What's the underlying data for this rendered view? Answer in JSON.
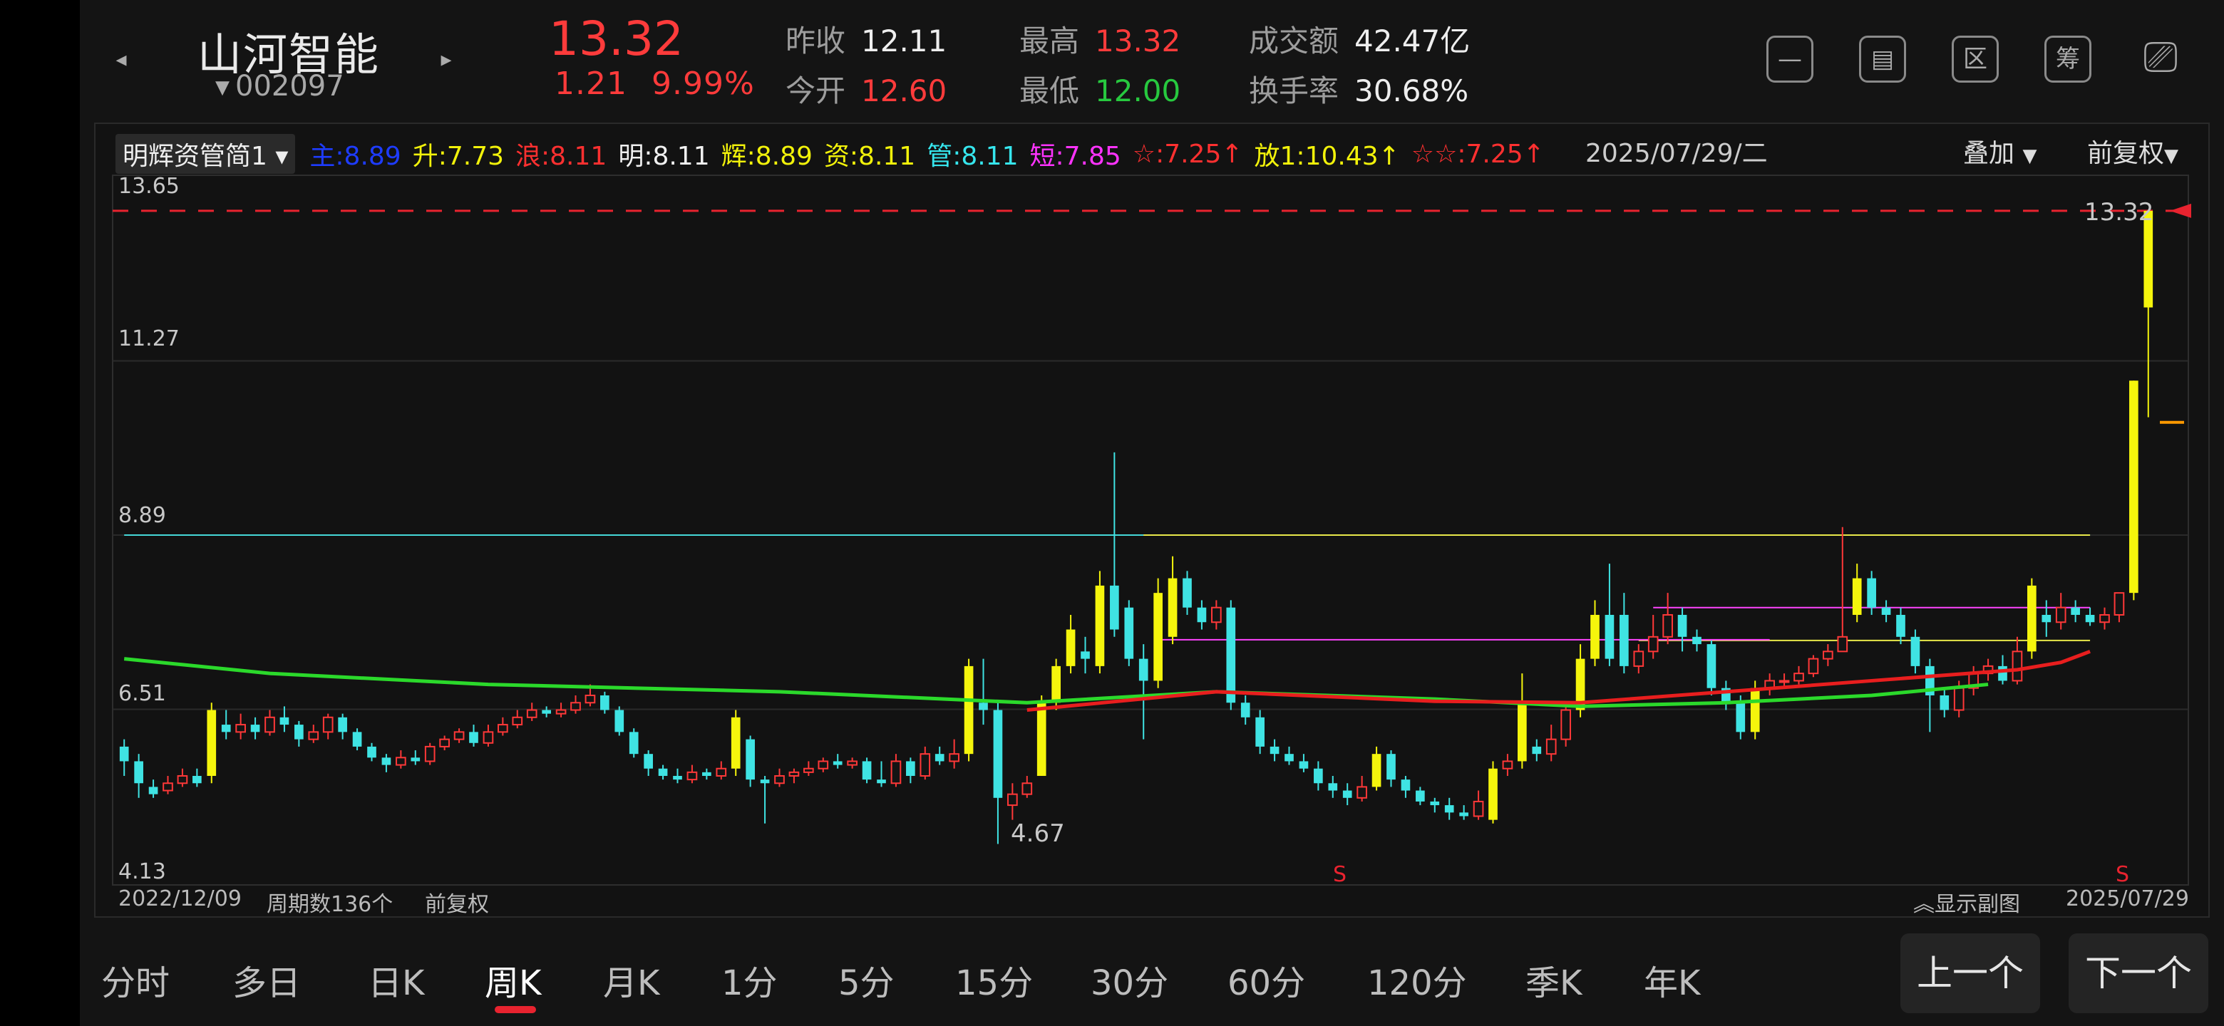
{
  "header": {
    "name": "山河智能",
    "code": "002097",
    "price": "13.32",
    "change": "1.21",
    "change_pct": "9.99%",
    "quotes": [
      {
        "k": "昨收",
        "v": "12.11",
        "c": "normal"
      },
      {
        "k": "今开",
        "v": "12.60",
        "c": "red"
      },
      {
        "k": "最高",
        "v": "13.32",
        "c": "red"
      },
      {
        "k": "最低",
        "v": "12.00",
        "c": "green"
      },
      {
        "k": "成交额",
        "v": "42.47亿",
        "c": "normal"
      },
      {
        "k": "换手率",
        "v": "30.68%",
        "c": "normal"
      }
    ],
    "tools": [
      "minus-icon",
      "frame-icon",
      "区",
      "筹",
      "rotate-screen-icon"
    ]
  },
  "indicator": {
    "selector": "明辉资管简1",
    "items": [
      {
        "t": "主:8.89",
        "c": "#1e3cff"
      },
      {
        "t": "升:7.73",
        "c": "#f2f20a"
      },
      {
        "t": "浪:8.11",
        "c": "#ff3030"
      },
      {
        "t": "明:8.11",
        "c": "#f0f0f0"
      },
      {
        "t": "辉:8.89",
        "c": "#f2f20a"
      },
      {
        "t": "资:8.11",
        "c": "#f2f20a"
      },
      {
        "t": "管:8.11",
        "c": "#36e6ee"
      },
      {
        "t": "短:7.85",
        "c": "#ff33ff"
      },
      {
        "t": "☆:7.25↑",
        "c": "#ff3030"
      },
      {
        "t": "放1:10.43↑",
        "c": "#f2f20a"
      },
      {
        "t": "☆☆:7.25↑",
        "c": "#ff3030"
      }
    ],
    "date": "2025/07/29/二",
    "overlay": "叠加",
    "adjust": "前复权"
  },
  "axis": {
    "y_labels": [
      "13.65",
      "11.27",
      "8.89",
      "6.51",
      "4.13"
    ],
    "low_mark": "4.67",
    "high_mark": "13.32",
    "start_date": "2022/12/09",
    "period_count": "周期数136个",
    "adjust_label": "前复权",
    "show_sub": "显示副图",
    "end_date": "2025/07/29",
    "signal": "S"
  },
  "chart_data": {
    "type": "candlestick",
    "ylim": [
      4.13,
      13.65
    ],
    "candles": [
      [
        6.0,
        5.8,
        6.1,
        5.6
      ],
      [
        5.8,
        5.5,
        5.9,
        5.3
      ],
      [
        5.45,
        5.35,
        5.55,
        5.3
      ],
      [
        5.4,
        5.5,
        5.6,
        5.35
      ],
      [
        5.5,
        5.6,
        5.7,
        5.45
      ],
      [
        5.6,
        5.5,
        5.7,
        5.45
      ],
      [
        5.6,
        6.5,
        6.6,
        5.5
      ],
      [
        6.3,
        6.2,
        6.5,
        6.1
      ],
      [
        6.2,
        6.3,
        6.45,
        6.1
      ],
      [
        6.3,
        6.2,
        6.4,
        6.1
      ],
      [
        6.2,
        6.4,
        6.5,
        6.15
      ],
      [
        6.4,
        6.3,
        6.55,
        6.2
      ],
      [
        6.3,
        6.1,
        6.35,
        6.0
      ],
      [
        6.1,
        6.2,
        6.3,
        6.05
      ],
      [
        6.2,
        6.4,
        6.45,
        6.1
      ],
      [
        6.4,
        6.2,
        6.45,
        6.1
      ],
      [
        6.2,
        6.0,
        6.25,
        5.95
      ],
      [
        6.0,
        5.85,
        6.05,
        5.8
      ],
      [
        5.85,
        5.75,
        5.9,
        5.65
      ],
      [
        5.75,
        5.85,
        5.95,
        5.7
      ],
      [
        5.85,
        5.8,
        5.95,
        5.75
      ],
      [
        5.8,
        6.0,
        6.05,
        5.75
      ],
      [
        6.0,
        6.1,
        6.15,
        5.95
      ],
      [
        6.1,
        6.2,
        6.25,
        6.05
      ],
      [
        6.2,
        6.05,
        6.3,
        6.0
      ],
      [
        6.05,
        6.2,
        6.3,
        6.0
      ],
      [
        6.2,
        6.3,
        6.4,
        6.15
      ],
      [
        6.3,
        6.4,
        6.5,
        6.25
      ],
      [
        6.4,
        6.5,
        6.6,
        6.35
      ],
      [
        6.5,
        6.45,
        6.55,
        6.4
      ],
      [
        6.45,
        6.5,
        6.6,
        6.4
      ],
      [
        6.5,
        6.6,
        6.7,
        6.45
      ],
      [
        6.6,
        6.7,
        6.85,
        6.55
      ],
      [
        6.7,
        6.5,
        6.75,
        6.45
      ],
      [
        6.5,
        6.2,
        6.55,
        6.15
      ],
      [
        6.2,
        5.9,
        6.25,
        5.85
      ],
      [
        5.9,
        5.7,
        5.95,
        5.6
      ],
      [
        5.7,
        5.6,
        5.75,
        5.55
      ],
      [
        5.6,
        5.55,
        5.7,
        5.5
      ],
      [
        5.55,
        5.65,
        5.75,
        5.5
      ],
      [
        5.65,
        5.6,
        5.7,
        5.55
      ],
      [
        5.6,
        5.7,
        5.8,
        5.55
      ],
      [
        5.7,
        6.4,
        6.5,
        5.6
      ],
      [
        6.1,
        5.55,
        6.15,
        5.45
      ],
      [
        5.55,
        5.5,
        5.6,
        4.95
      ],
      [
        5.5,
        5.6,
        5.7,
        5.45
      ],
      [
        5.6,
        5.65,
        5.7,
        5.5
      ],
      [
        5.65,
        5.7,
        5.8,
        5.6
      ],
      [
        5.7,
        5.8,
        5.85,
        5.65
      ],
      [
        5.8,
        5.75,
        5.9,
        5.7
      ],
      [
        5.75,
        5.8,
        5.85,
        5.7
      ],
      [
        5.8,
        5.55,
        5.85,
        5.5
      ],
      [
        5.55,
        5.5,
        5.8,
        5.45
      ],
      [
        5.5,
        5.8,
        5.9,
        5.45
      ],
      [
        5.8,
        5.6,
        5.85,
        5.5
      ],
      [
        5.6,
        5.9,
        6.0,
        5.55
      ],
      [
        5.9,
        5.8,
        6.0,
        5.75
      ],
      [
        5.8,
        5.9,
        6.1,
        5.7
      ],
      [
        5.9,
        7.1,
        7.2,
        5.8
      ],
      [
        6.6,
        6.5,
        7.2,
        6.3
      ],
      [
        6.5,
        5.3,
        6.6,
        4.67
      ],
      [
        5.2,
        5.35,
        5.5,
        5.0
      ],
      [
        5.35,
        5.5,
        5.6,
        5.3
      ],
      [
        5.6,
        6.6,
        6.7,
        5.6
      ],
      [
        6.6,
        7.1,
        7.2,
        6.5
      ],
      [
        7.1,
        7.6,
        7.8,
        7.0
      ],
      [
        7.3,
        7.2,
        7.5,
        7.0
      ],
      [
        7.1,
        8.2,
        8.4,
        7.0
      ],
      [
        8.2,
        7.6,
        10.02,
        7.5
      ],
      [
        7.9,
        7.2,
        8.0,
        7.1
      ],
      [
        7.2,
        6.9,
        7.4,
        6.1
      ],
      [
        6.9,
        8.1,
        8.3,
        6.8
      ],
      [
        7.5,
        8.3,
        8.6,
        7.4
      ],
      [
        8.3,
        7.9,
        8.4,
        7.8
      ],
      [
        7.9,
        7.7,
        8.0,
        7.6
      ],
      [
        7.7,
        7.9,
        8.0,
        7.6
      ],
      [
        7.9,
        6.6,
        8.0,
        6.5
      ],
      [
        6.6,
        6.4,
        6.7,
        6.3
      ],
      [
        6.4,
        6.0,
        6.5,
        5.9
      ],
      [
        6.0,
        5.9,
        6.1,
        5.8
      ],
      [
        5.9,
        5.8,
        6.0,
        5.75
      ],
      [
        5.8,
        5.7,
        5.9,
        5.65
      ],
      [
        5.7,
        5.5,
        5.8,
        5.4
      ],
      [
        5.5,
        5.4,
        5.6,
        5.3
      ],
      [
        5.4,
        5.3,
        5.5,
        5.2
      ],
      [
        5.3,
        5.45,
        5.6,
        5.25
      ],
      [
        5.45,
        5.9,
        6.0,
        5.4
      ],
      [
        5.9,
        5.55,
        5.95,
        5.45
      ],
      [
        5.55,
        5.4,
        5.6,
        5.3
      ],
      [
        5.4,
        5.25,
        5.45,
        5.2
      ],
      [
        5.25,
        5.2,
        5.3,
        5.1
      ],
      [
        5.2,
        5.1,
        5.3,
        5.0
      ],
      [
        5.1,
        5.05,
        5.2,
        5.0
      ],
      [
        5.05,
        5.25,
        5.4,
        5.0
      ],
      [
        5.0,
        5.7,
        5.8,
        4.95
      ],
      [
        5.7,
        5.8,
        5.9,
        5.6
      ],
      [
        5.8,
        6.6,
        7.0,
        5.7
      ],
      [
        6.0,
        5.9,
        6.1,
        5.8
      ],
      [
        5.9,
        6.1,
        6.3,
        5.8
      ],
      [
        6.1,
        6.5,
        6.6,
        6.0
      ],
      [
        6.5,
        7.2,
        7.4,
        6.4
      ],
      [
        7.2,
        7.8,
        8.0,
        7.1
      ],
      [
        7.8,
        7.2,
        8.5,
        7.1
      ],
      [
        7.8,
        7.1,
        8.1,
        7.0
      ],
      [
        7.1,
        7.3,
        7.4,
        7.0
      ],
      [
        7.3,
        7.5,
        7.8,
        7.2
      ],
      [
        7.5,
        7.8,
        8.1,
        7.4
      ],
      [
        7.8,
        7.5,
        7.9,
        7.3
      ],
      [
        7.5,
        7.4,
        7.6,
        7.3
      ],
      [
        7.4,
        6.8,
        7.45,
        6.7
      ],
      [
        6.8,
        6.6,
        6.9,
        6.5
      ],
      [
        6.6,
        6.2,
        6.7,
        6.1
      ],
      [
        6.2,
        6.8,
        6.9,
        6.1
      ],
      [
        6.8,
        6.9,
        7.0,
        6.7
      ],
      [
        6.9,
        6.9,
        7.0,
        6.8
      ],
      [
        6.9,
        7.0,
        7.1,
        6.85
      ],
      [
        7.0,
        7.2,
        7.25,
        6.95
      ],
      [
        7.2,
        7.3,
        7.4,
        7.1
      ],
      [
        7.3,
        7.5,
        9.0,
        7.3
      ],
      [
        7.8,
        8.3,
        8.5,
        7.7
      ],
      [
        8.3,
        7.9,
        8.4,
        7.8
      ],
      [
        7.9,
        7.8,
        8.0,
        7.7
      ],
      [
        7.8,
        7.5,
        7.9,
        7.4
      ],
      [
        7.5,
        7.1,
        7.6,
        7.0
      ],
      [
        7.1,
        6.7,
        7.2,
        6.2
      ],
      [
        6.7,
        6.5,
        6.8,
        6.4
      ],
      [
        6.5,
        6.8,
        6.9,
        6.4
      ],
      [
        6.8,
        7.0,
        7.1,
        6.7
      ],
      [
        7.0,
        7.1,
        7.2,
        6.9
      ],
      [
        7.1,
        6.9,
        7.25,
        6.85
      ],
      [
        6.9,
        7.3,
        7.5,
        6.85
      ],
      [
        7.3,
        8.2,
        8.3,
        7.2
      ],
      [
        7.8,
        7.7,
        8.0,
        7.5
      ],
      [
        7.7,
        7.9,
        8.1,
        7.6
      ],
      [
        7.9,
        7.8,
        8.0,
        7.7
      ],
      [
        7.8,
        7.7,
        7.9,
        7.65
      ],
      [
        7.7,
        7.8,
        7.9,
        7.6
      ],
      [
        7.8,
        8.1,
        8.1,
        7.7
      ],
      [
        8.1,
        11.0,
        11.0,
        8.0
      ],
      [
        12.0,
        13.32,
        13.32,
        10.5
      ]
    ],
    "ma_green": [
      [
        0,
        7.2
      ],
      [
        10,
        7.0
      ],
      [
        25,
        6.85
      ],
      [
        45,
        6.75
      ],
      [
        62,
        6.6
      ],
      [
        75,
        6.75
      ],
      [
        90,
        6.65
      ],
      [
        100,
        6.55
      ],
      [
        110,
        6.6
      ],
      [
        120,
        6.7
      ],
      [
        128,
        6.85
      ]
    ],
    "ma_red": [
      [
        62,
        6.5
      ],
      [
        75,
        6.75
      ],
      [
        90,
        6.62
      ],
      [
        100,
        6.6
      ],
      [
        110,
        6.75
      ],
      [
        120,
        6.9
      ],
      [
        130,
        7.05
      ],
      [
        133,
        7.15
      ],
      [
        135,
        7.3
      ]
    ],
    "h_lines": [
      {
        "y": 8.89,
        "color": "#46d9d9",
        "from": 0,
        "to": 135
      },
      {
        "y": 8.89,
        "color": "#e8e84a",
        "from": 70,
        "to": 135
      },
      {
        "y": 7.9,
        "color": "#ff44ff",
        "from": 105,
        "to": 135
      },
      {
        "y": 7.45,
        "color": "#e8e84a",
        "from": 104,
        "to": 135
      },
      {
        "y": 7.46,
        "color": "#ff44ff",
        "from": 71,
        "to": 113
      }
    ],
    "dash_top": 13.32
  },
  "tabs": {
    "items": [
      "分时",
      "多日",
      "日K",
      "周K",
      "月K",
      "1分",
      "5分",
      "15分",
      "30分",
      "60分",
      "120分",
      "季K",
      "年K"
    ],
    "active": 3,
    "prev": "上一个",
    "next": "下一个"
  }
}
